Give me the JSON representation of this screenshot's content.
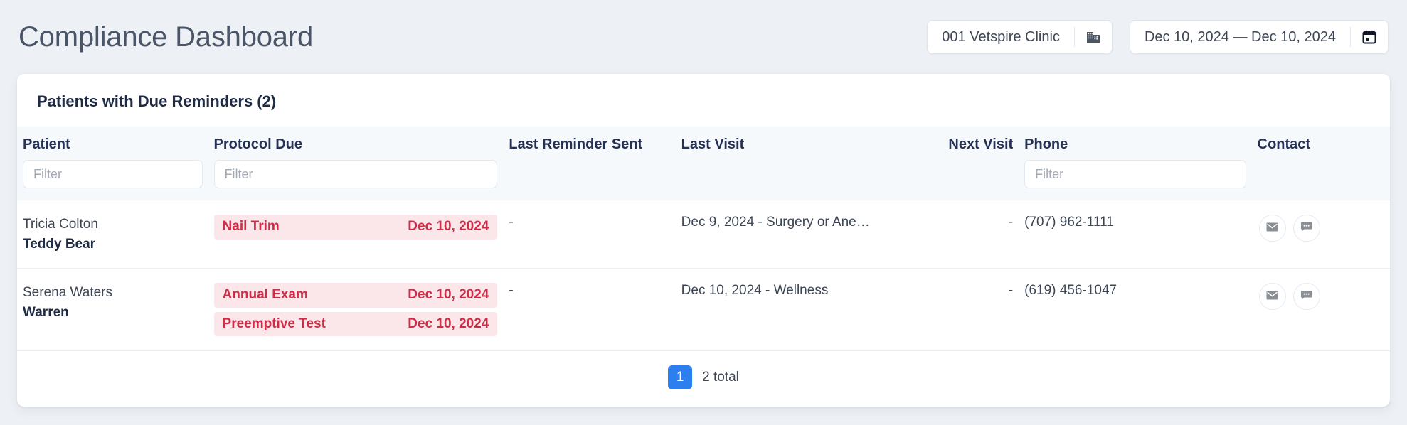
{
  "header": {
    "title": "Compliance Dashboard",
    "clinic_selector": {
      "value": "001 Vetspire Clinic",
      "icon": "building-icon"
    },
    "date_range": {
      "value": "Dec 10, 2024 — Dec 10, 2024",
      "icon": "calendar-icon"
    }
  },
  "card": {
    "title": "Patients with Due Reminders (2)",
    "columns": [
      {
        "key": "patient",
        "label": "Patient",
        "filter": "Filter"
      },
      {
        "key": "protocol",
        "label": "Protocol Due",
        "filter": "Filter"
      },
      {
        "key": "lastrem",
        "label": "Last Reminder Sent",
        "filter": null
      },
      {
        "key": "lastvisit",
        "label": "Last Visit",
        "filter": null
      },
      {
        "key": "nextvisit",
        "label": "Next Visit",
        "filter": null
      },
      {
        "key": "phone",
        "label": "Phone",
        "filter": "Filter"
      },
      {
        "key": "contact",
        "label": "Contact",
        "filter": null
      }
    ],
    "rows": [
      {
        "owner": "Tricia Colton",
        "pet": "Teddy Bear",
        "protocols": [
          {
            "name": "Nail Trim",
            "due": "Dec 10, 2024"
          }
        ],
        "last_reminder_sent": "-",
        "last_visit": "Dec 9, 2024 - Surgery or Ane…",
        "next_visit": "-",
        "phone": "(707) 962-1111",
        "contact": {
          "email_icon": "envelope-icon",
          "message_icon": "chat-bubble-icon"
        }
      },
      {
        "owner": "Serena Waters",
        "pet": "Warren",
        "protocols": [
          {
            "name": "Annual Exam",
            "due": "Dec 10, 2024"
          },
          {
            "name": "Preemptive Test",
            "due": "Dec 10, 2024"
          }
        ],
        "last_reminder_sent": "-",
        "last_visit": "Dec 10, 2024 - Wellness",
        "next_visit": "-",
        "phone": "(619) 456-1047",
        "contact": {
          "email_icon": "envelope-icon",
          "message_icon": "chat-bubble-icon"
        }
      }
    ],
    "pagination": {
      "current_page": "1",
      "total_label": "2 total"
    }
  },
  "colors": {
    "page_background": "#edf1f5",
    "accent_blue": "#2d7ff0",
    "due_red": "#cf2c48",
    "due_red_background": "#fbe6e9",
    "header_row_background": "#f6f9fc"
  }
}
